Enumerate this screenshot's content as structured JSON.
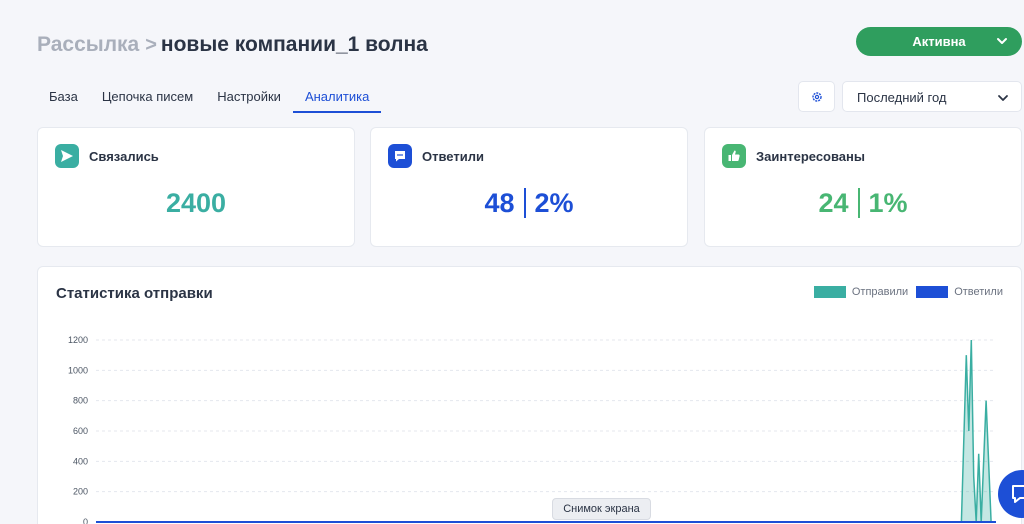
{
  "breadcrumb": {
    "root": "Рассылка",
    "separator": ">",
    "current": "новые компании_1 волна"
  },
  "status": {
    "label": "Активна"
  },
  "tabs": [
    {
      "label": "База"
    },
    {
      "label": "Цепочка писем"
    },
    {
      "label": "Настройки"
    },
    {
      "label": "Аналитика",
      "active": true
    }
  ],
  "period": {
    "selected": "Последний год"
  },
  "colors": {
    "accent": "#1d4fd6",
    "status": "#2f9e5e",
    "teal": "#3aaea2",
    "green": "#48b673"
  },
  "cards": [
    {
      "title": "Связались",
      "icon": "send-icon",
      "icon_color": "#3aaea2",
      "value": "2400",
      "percent": ""
    },
    {
      "title": "Ответили",
      "icon": "chat-bubble-icon",
      "icon_color": "#1d4fd6",
      "value": "48",
      "percent": "2%"
    },
    {
      "title": "Заинтересованы",
      "icon": "thumbs-up-icon",
      "icon_color": "#48b673",
      "value": "24",
      "percent": "1%"
    }
  ],
  "stats": {
    "title": "Статистика отправки",
    "legend": [
      {
        "label": "Отправили",
        "color": "#3aaea2"
      },
      {
        "label": "Ответили",
        "color": "#1d4fd6"
      }
    ]
  },
  "chart_data": {
    "type": "area",
    "yticks": [
      0,
      200,
      400,
      600,
      800,
      1000,
      1200
    ],
    "ylim": [
      0,
      1300
    ],
    "x_count": 365,
    "series": [
      {
        "name": "Отправили",
        "points": [
          [
            0,
            0
          ],
          [
            350,
            0
          ],
          [
            352,
            1100
          ],
          [
            353,
            600
          ],
          [
            354,
            1200
          ],
          [
            355,
            300
          ],
          [
            356,
            0
          ],
          [
            357,
            450
          ],
          [
            358,
            0
          ],
          [
            360,
            800
          ],
          [
            362,
            0
          ],
          [
            364,
            0
          ]
        ]
      },
      {
        "name": "Ответили",
        "points": [
          [
            0,
            0
          ],
          [
            364,
            0
          ]
        ]
      }
    ]
  },
  "tooltip": {
    "label": "Снимок экрана"
  },
  "chat": {
    "icon": "chat-icon"
  }
}
